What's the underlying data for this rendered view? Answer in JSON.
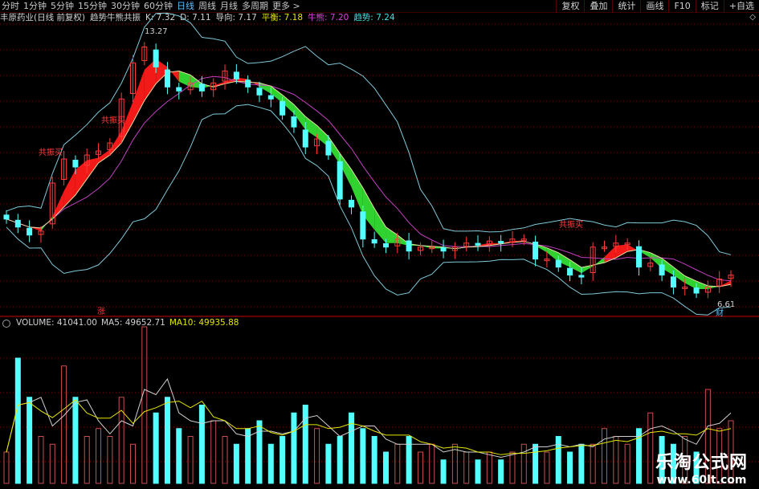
{
  "toolbar": {
    "periods": [
      "分时",
      "1分钟",
      "5分钟",
      "15分钟",
      "30分钟",
      "60分钟",
      "日线",
      "周线",
      "月线",
      "多周期",
      "更多 >"
    ],
    "active_period": "日线",
    "actions": [
      "复权",
      "叠加",
      "统计",
      "画线",
      "F10",
      "标记",
      "+自选"
    ]
  },
  "info": {
    "stock": "丰原药业(日线 前复权)",
    "indicator": "趋势牛熊共振",
    "k": "K: 7.32",
    "d": "D: 7.11",
    "guide": "导向: 7.17",
    "level": "平衡: 7.18",
    "bull": "牛熊: 7.20",
    "trend": "趋势: 7.24"
  },
  "annotations": {
    "high": "13.27",
    "low": "6.61",
    "buy1": "共振买",
    "buy2": "共振买",
    "buy3": "共振买",
    "zhang": "涨",
    "cai": "财"
  },
  "volume": {
    "title": "VOLUME: 41041.00",
    "ma5": "MA5: 49652.71",
    "ma10": "MA10: 49935.88"
  },
  "watermark": {
    "cn": "乐淘公式网",
    "url": "www.60lt.com"
  },
  "colors": {
    "up": "#ff3b3b",
    "down": "#54ffff",
    "grid": "#8b0000",
    "band": "#7fc8d8",
    "ma_purple": "#c040c0",
    "ma_yellow": "#e8e0a0",
    "ribbon_red": "#ff1a1a",
    "ribbon_green": "#33dd33"
  },
  "chart_data": {
    "type": "candlestick",
    "price_axis": {
      "high": 13.27,
      "low": 6.61
    },
    "closes": [
      8.6,
      8.4,
      8.2,
      8.3,
      9.5,
      10.1,
      9.9,
      10.2,
      10.3,
      10.5,
      11.6,
      12.5,
      12.9,
      12.4,
      11.9,
      11.8,
      12.0,
      11.8,
      12.0,
      12.3,
      12.1,
      11.9,
      11.7,
      11.6,
      11.2,
      10.9,
      10.4,
      10.6,
      10.2,
      9.1,
      8.9,
      8.1,
      8.0,
      7.9,
      8.1,
      7.8,
      7.9,
      7.9,
      7.8,
      7.9,
      8.0,
      7.95,
      8.05,
      8.0,
      8.1,
      8.1,
      7.6,
      7.6,
      7.4,
      7.2,
      7.15,
      7.9,
      7.9,
      8.0,
      8.0,
      7.4,
      7.5,
      7.2,
      6.9,
      6.9,
      6.75,
      6.9,
      7.1,
      7.2
    ]
  }
}
